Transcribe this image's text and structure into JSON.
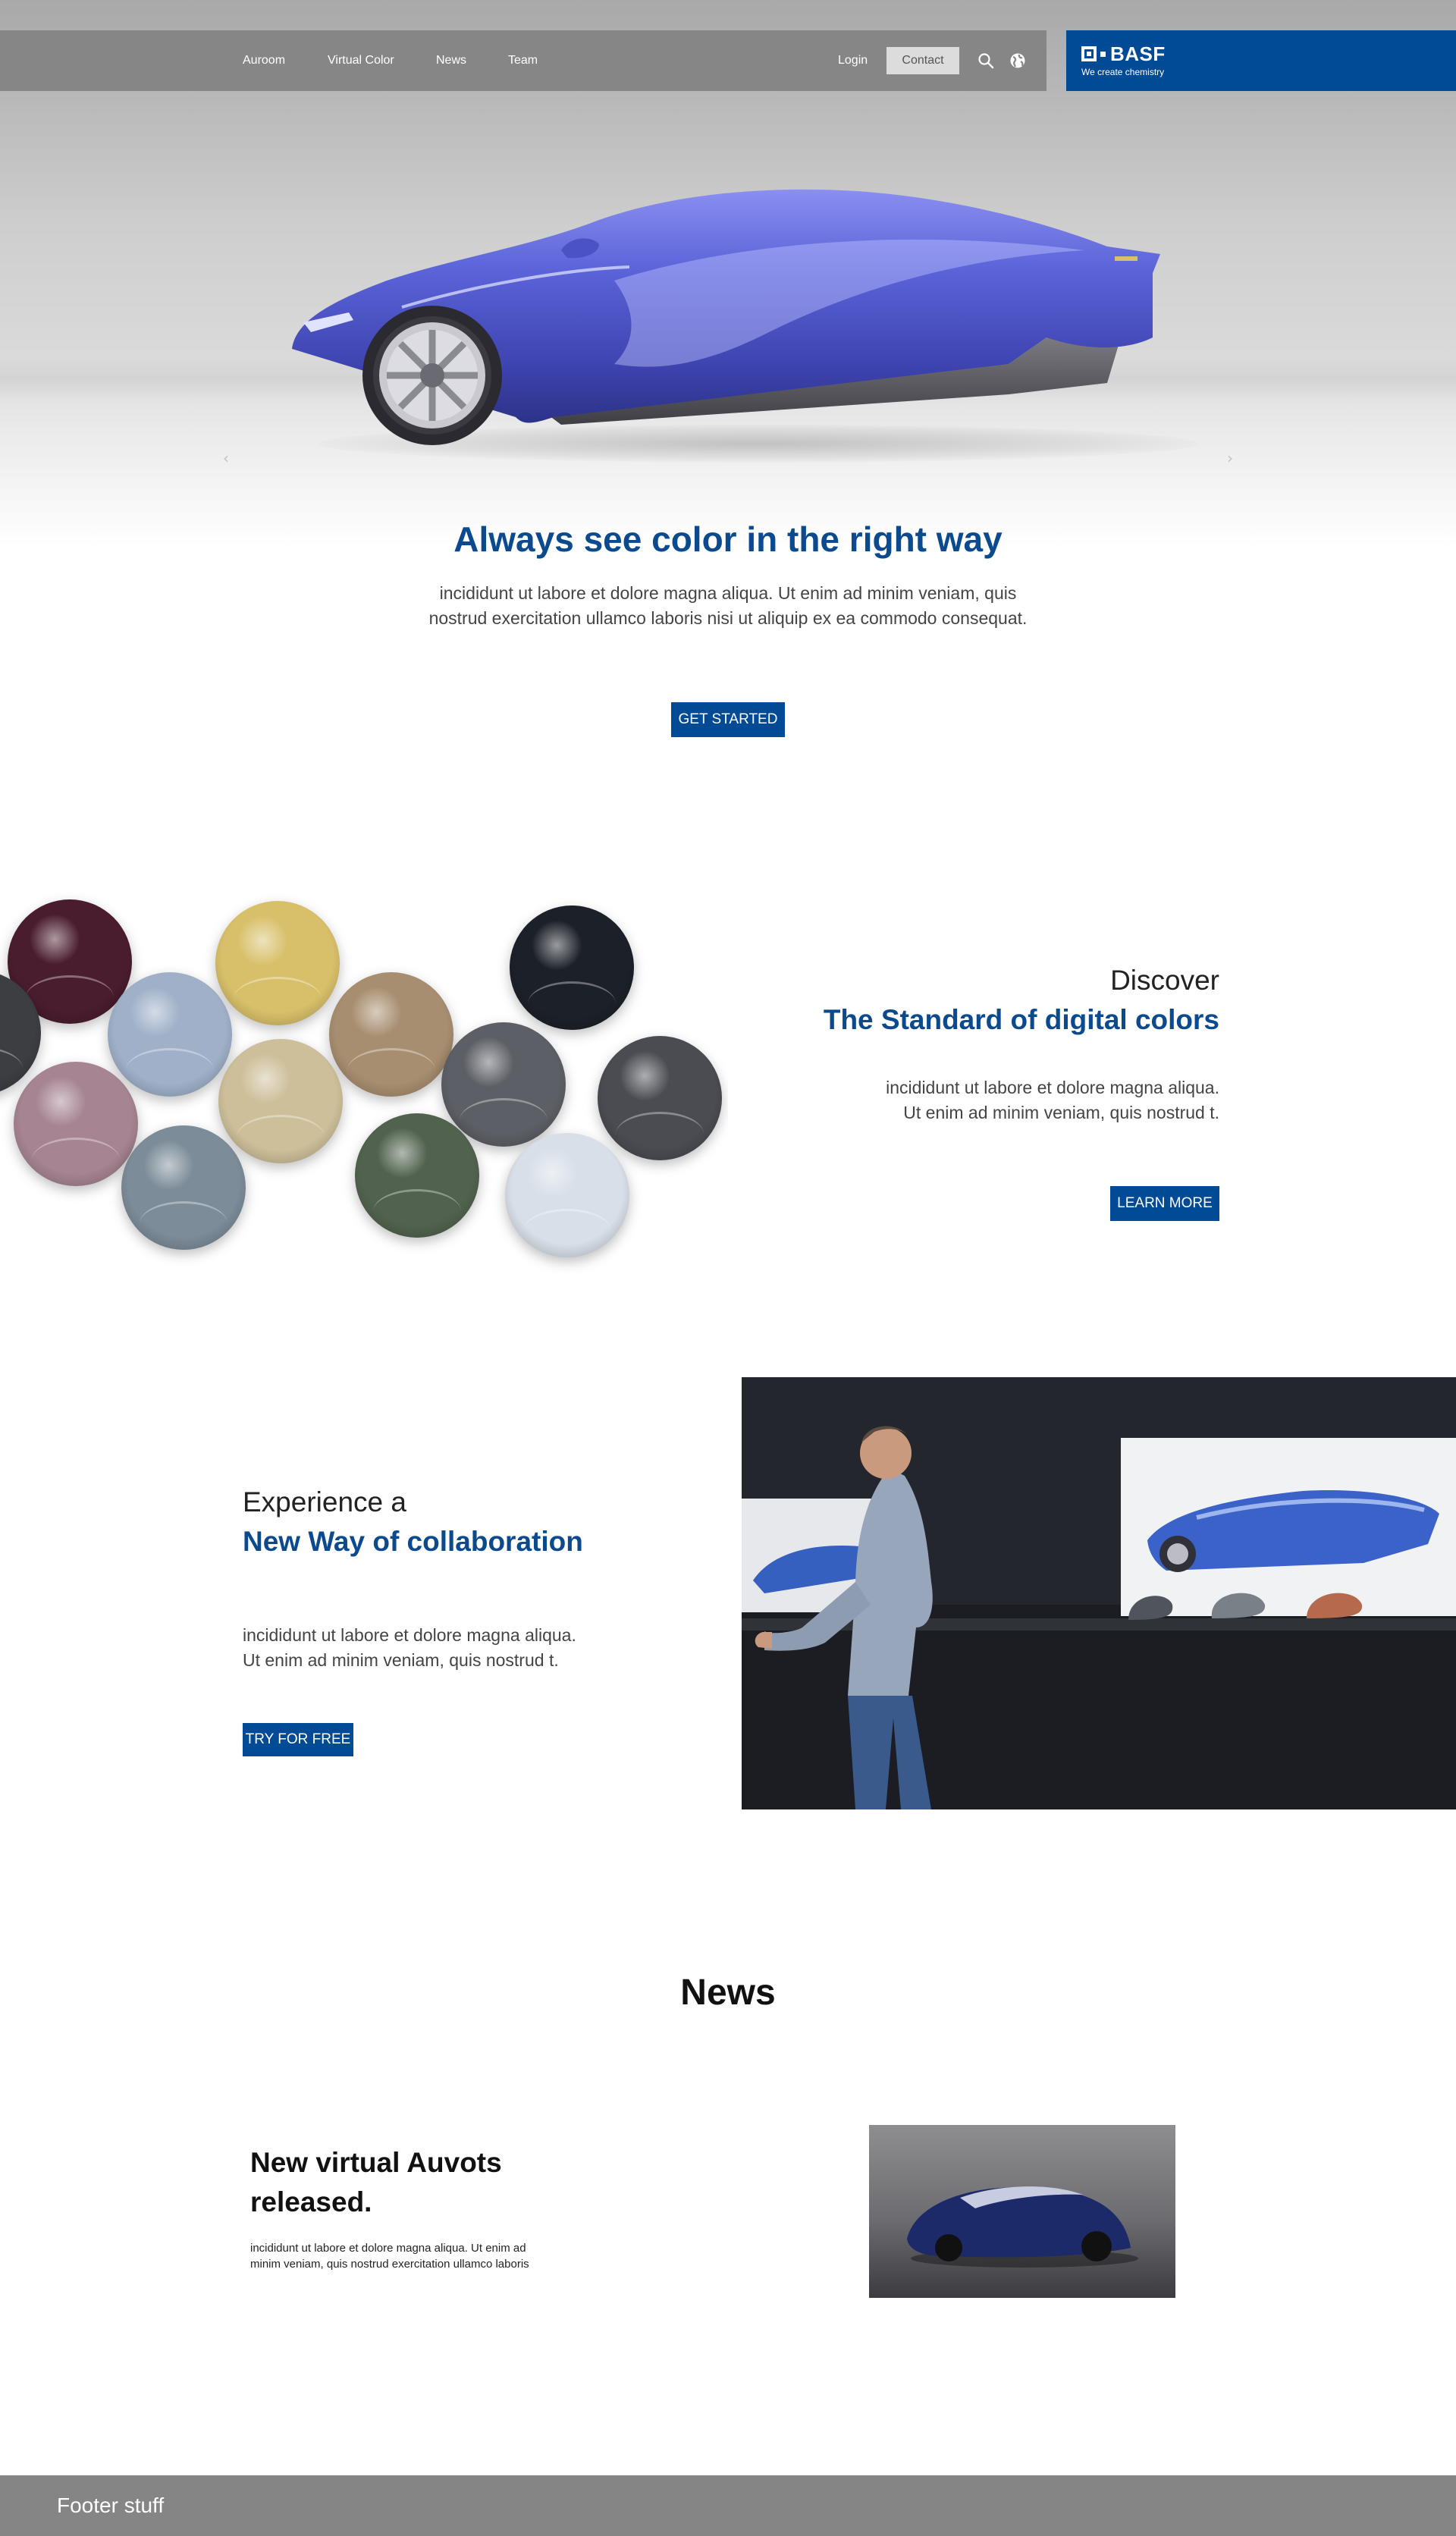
{
  "nav": {
    "items": [
      {
        "label": "Auroom"
      },
      {
        "label": "Virtual Color"
      },
      {
        "label": "News"
      },
      {
        "label": "Team"
      }
    ],
    "login": "Login",
    "contact": "Contact",
    "icons": [
      "search-icon",
      "globe-icon"
    ]
  },
  "brand": {
    "name": "BASF",
    "tagline": "We create chemistry",
    "color": "#004a96"
  },
  "carousel": {
    "prev_icon": "‹",
    "next_icon": "›"
  },
  "hero": {
    "title": "Always see color in the right way",
    "body": "incididunt ut labore et dolore magna aliqua. Ut enim ad minim veniam, quis nostrud exercitation ullamco laboris nisi ut aliquip ex ea commodo consequat.",
    "cta": "GET STARTED"
  },
  "discover": {
    "kicker": "Discover",
    "title": "The Standard of digital colors",
    "body": "incididunt ut labore et dolore magna aliqua. Ut enim ad minim veniam, quis nostrud t.",
    "cta": "LEARN MORE",
    "swatch_colors": [
      "#4a1d2e",
      "#d8c06a",
      "#1c2028",
      "#3c3e42",
      "#9fb0c8",
      "#a88e70",
      "#5d5f66",
      "#a68492",
      "#cdbf9a",
      "#4a4c52",
      "#7c8c98",
      "#51634e",
      "#d8dfe8"
    ]
  },
  "experience": {
    "kicker": "Experience a",
    "title": "New Way of collaboration",
    "body": "incididunt ut labore et dolore magna aliqua. Ut enim ad minim veniam, quis nostrud t.",
    "cta": "TRY FOR FREE"
  },
  "news": {
    "heading": "News",
    "item": {
      "title": "New virtual Auvots released.",
      "body": "incididunt ut labore et dolore magna aliqua. Ut enim ad minim veniam, quis nostrud exercitation ullamco laboris"
    }
  },
  "footer": {
    "text": "Footer stuff"
  },
  "colors": {
    "accent": "#004a96",
    "heading_blue": "#0b4a8e",
    "nav_gray": "#868686",
    "footer_gray": "#858585"
  }
}
